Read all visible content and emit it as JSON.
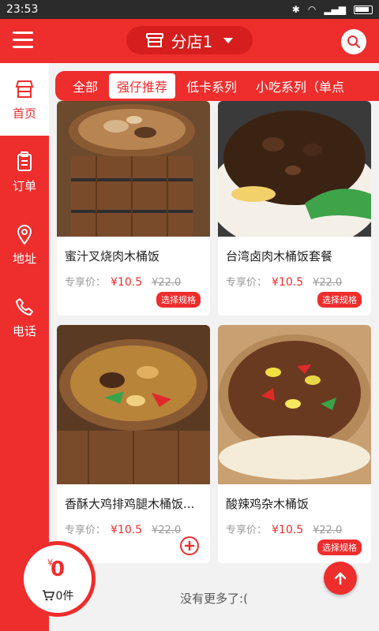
{
  "status_bar": {
    "time": "23:53"
  },
  "header": {
    "store_name": "分店1"
  },
  "sidebar": {
    "items": [
      {
        "label": "首页",
        "icon": "store-icon",
        "active": true
      },
      {
        "label": "订单",
        "icon": "clipboard-icon",
        "active": false
      },
      {
        "label": "地址",
        "icon": "location-pin-icon",
        "active": false
      },
      {
        "label": "电话",
        "icon": "phone-icon",
        "active": false
      }
    ]
  },
  "tabs": [
    {
      "label": "全部",
      "active": false
    },
    {
      "label": "强仔推荐",
      "active": true
    },
    {
      "label": "低卡系列",
      "active": false
    },
    {
      "label": "小吃系列（单点",
      "active": false
    }
  ],
  "products": [
    {
      "name": "蜜汁叉烧肉木桶饭",
      "price_label": "专享价：",
      "price": "¥10.5",
      "original_price": "¥22.0",
      "action": "选择规格"
    },
    {
      "name": "台湾卤肉木桶饭套餐",
      "price_label": "专享价：",
      "price": "¥10.5",
      "original_price": "¥22.0",
      "action": "选择规格"
    },
    {
      "name": "香酥大鸡排鸡腿木桶饭...",
      "price_label": "专享价：",
      "price": "¥10.5",
      "original_price": "¥22.0",
      "action": "plus-icon"
    },
    {
      "name": "酸辣鸡杂木桶饭",
      "price_label": "专享价：",
      "price": "¥10.5",
      "original_price": "¥22.0",
      "action": "选择规格"
    }
  ],
  "footer": {
    "no_more": "没有更多了:("
  },
  "cart": {
    "currency": "¥",
    "total": "0",
    "count_text": "0件"
  },
  "colors": {
    "primary": "#ee2d2d",
    "price": "#ee2d2d",
    "muted": "#9a9a9a"
  }
}
